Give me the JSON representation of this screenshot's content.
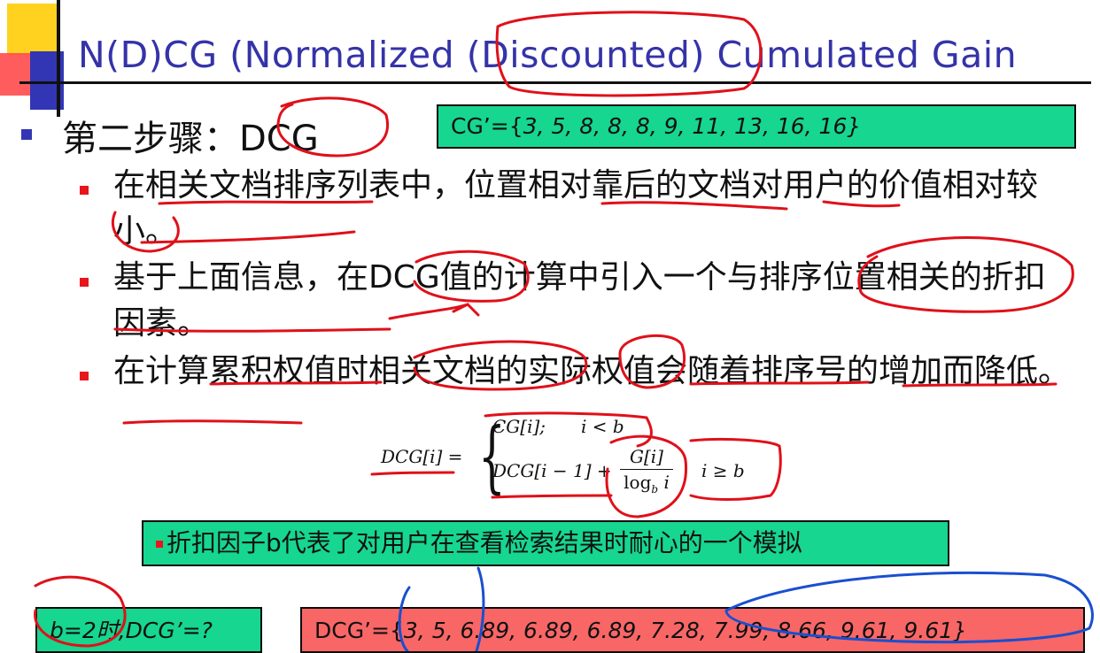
{
  "slide": {
    "title": "N(D)CG (Normalized (Discounted) Cumulated Gain",
    "step_label": "第二步骤：",
    "step_term": "DCG",
    "cg_prefix": "CG’={",
    "cg_values": "3, 5, 8, 8, 8, 9, 11, 13, 16, 16}",
    "bullets": [
      {
        "text": "在相关文档排序列表中，位置相对靠后的文档对用户的价值相对较小。"
      },
      {
        "text_a": "基于上面信息，在",
        "term": "DCG",
        "text_b": "值的计算中引入一个与排序位置相关的折扣因素。"
      },
      {
        "text": "在计算累积权值时相关文档的实际权值会随着排序号的增加而降低。"
      }
    ],
    "formula": {
      "lhs": "DCG[i] =",
      "case1": "CG[i];",
      "cond1": "i < b",
      "case2": "DCG[i − 1] +",
      "frac_num": "G[i]",
      "frac_den": "log",
      "frac_den_base": "b",
      "frac_den_var": "i",
      "cond2": "i ≥ b"
    },
    "note": "折扣因子b代表了对用户在查看检索结果时耐心的一个模拟",
    "question": "b=2时,DCG’=?",
    "dcg_prefix": "DCG’={",
    "dcg_values": "3, 5, 6.89, 6.89, 6.89, 7.28, 7.99, 8.66, 9.61, 9.61}"
  },
  "colors": {
    "title": "#3533a8",
    "green_box": "#16d690",
    "red_box": "#f86666",
    "bullet_red": "#e8161b",
    "bullet_blue": "#3236b5",
    "ink_red": "#e0101a",
    "ink_blue": "#1a4fd0"
  }
}
